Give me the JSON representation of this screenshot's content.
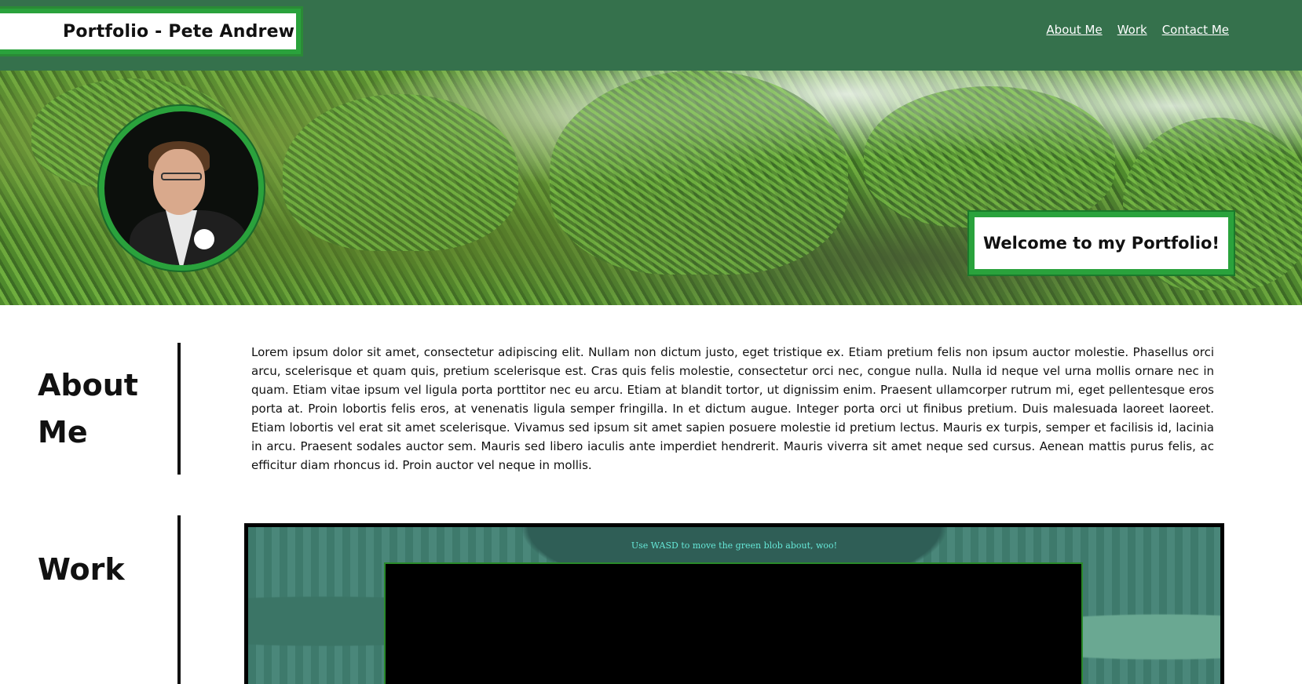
{
  "header": {
    "site_title": "Portfolio - Pete Andrew",
    "nav": [
      {
        "label": "About Me"
      },
      {
        "label": "Work"
      },
      {
        "label": "Contact Me"
      }
    ]
  },
  "hero": {
    "welcome": "Welcome to my Portfolio!"
  },
  "about": {
    "heading_line1": "About",
    "heading_line2": "Me",
    "body": "Lorem ipsum dolor sit amet, consectetur adipiscing elit. Nullam non dictum justo, eget tristique ex. Etiam pretium felis non ipsum auctor molestie. Phasellus orci arcu, scelerisque et quam quis, pretium scelerisque est. Cras quis felis molestie, consectetur orci nec, congue nulla. Nulla id neque vel urna mollis ornare nec in quam. Etiam vitae ipsum vel ligula porta porttitor nec eu arcu. Etiam at blandit tortor, ut dignissim enim. Praesent ullamcorper rutrum mi, eget pellentesque eros porta at. Proin lobortis felis eros, at venenatis ligula semper fringilla. In et dictum augue. Integer porta orci ut finibus pretium. Duis malesuada laoreet laoreet. Etiam lobortis vel erat sit amet scelerisque. Vivamus sed ipsum sit amet sapien posuere molestie id pretium lectus. Mauris ex turpis, semper et facilisis id, lacinia in arcu. Praesent sodales auctor sem. Mauris sed libero iaculis ante imperdiet hendrerit. Mauris viverra sit amet neque sed cursus. Aenean mattis purus felis, ac efficitur diam rhoncus id. Proin auctor vel neque in mollis."
  },
  "work": {
    "heading": "Work",
    "game_caption": "Use WASD to move the green blob about, woo!"
  },
  "colors": {
    "header_bg": "#35714c",
    "accent_green": "#2aa23c",
    "game_caption": "#66e8d8"
  }
}
